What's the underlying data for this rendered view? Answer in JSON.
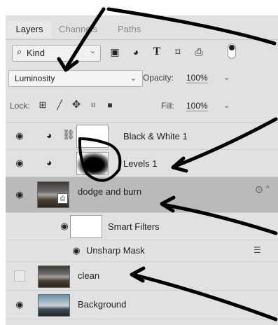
{
  "tabs": {
    "layers": "Layers",
    "channels": "Channels",
    "paths": "Paths"
  },
  "filter": {
    "kind_label": "Kind",
    "icons": [
      "image-filter-icon",
      "adjustment-filter-icon",
      "type-filter-icon",
      "shape-filter-icon",
      "smart-object-filter-icon"
    ]
  },
  "blend": {
    "mode": "Luminosity",
    "opacity_label": "Opacity:",
    "opacity": "100%"
  },
  "lock": {
    "label": "Lock:",
    "fill_label": "Fill:",
    "fill": "100%"
  },
  "layers": [
    {
      "name": "Black & White 1",
      "visible": true,
      "type": "adjustment"
    },
    {
      "name": "Levels 1",
      "visible": true,
      "type": "adjustment"
    },
    {
      "name": "dodge and burn",
      "visible": true,
      "type": "smart-object",
      "selected": true
    },
    {
      "name": "Smart Filters",
      "visible": true,
      "type": "smart-filters"
    },
    {
      "name": "Unsharp Mask",
      "visible": true,
      "type": "filter"
    },
    {
      "name": "clean",
      "visible": false,
      "type": "pixel"
    },
    {
      "name": "Background",
      "visible": true,
      "type": "pixel"
    }
  ],
  "icons": {
    "eye": "eye-icon",
    "arrow": "annotation-arrow"
  }
}
